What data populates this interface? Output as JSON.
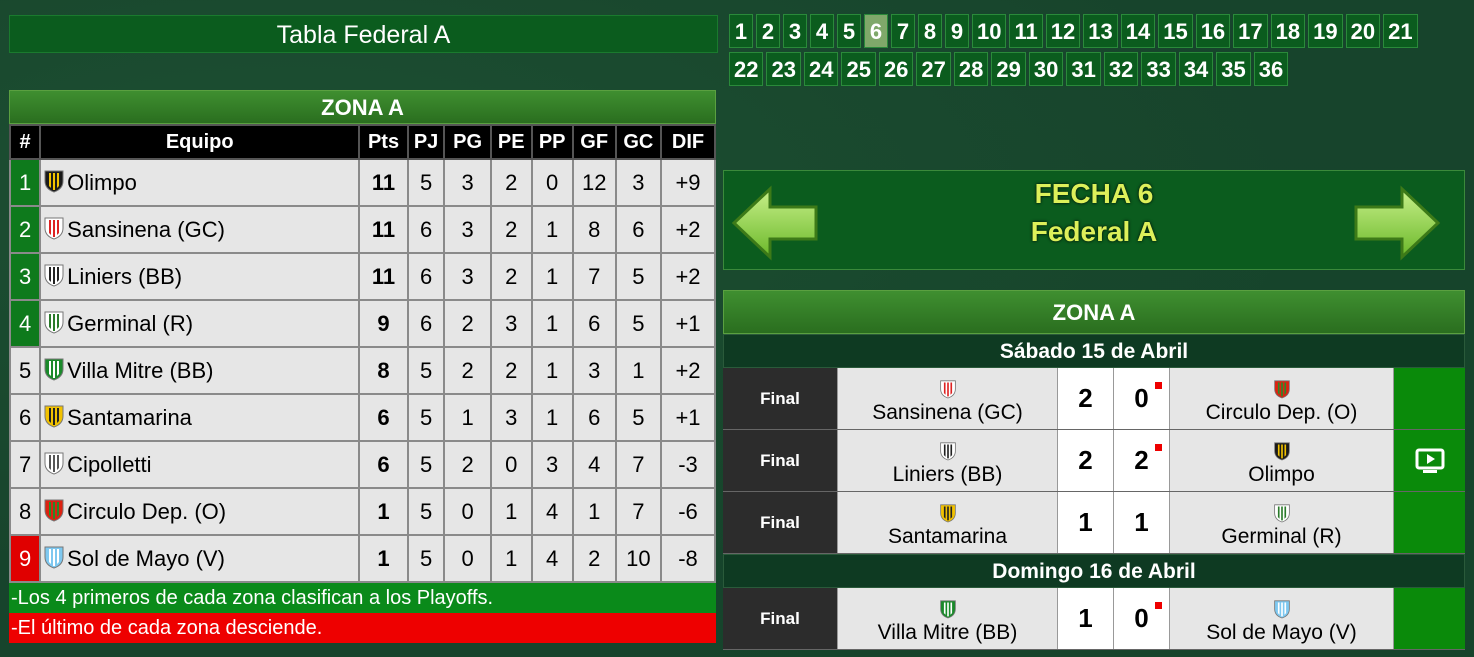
{
  "page_title": "Tabla Federal A",
  "standings": {
    "zone_title": "ZONA A",
    "columns": [
      "#",
      "Equipo",
      "Pts",
      "PJ",
      "PG",
      "PE",
      "PP",
      "GF",
      "GC",
      "DIF"
    ],
    "rows": [
      {
        "pos": "1",
        "team": "Olimpo",
        "pts": "11",
        "pj": "5",
        "pg": "3",
        "pe": "2",
        "pp": "0",
        "gf": "12",
        "gc": "3",
        "dif": "+9",
        "status": "green",
        "crest": "olimpo-crest"
      },
      {
        "pos": "2",
        "team": "Sansinena (GC)",
        "pts": "11",
        "pj": "6",
        "pg": "3",
        "pe": "2",
        "pp": "1",
        "gf": "8",
        "gc": "6",
        "dif": "+2",
        "status": "green",
        "crest": "sansinena-crest"
      },
      {
        "pos": "3",
        "team": "Liniers (BB)",
        "pts": "11",
        "pj": "6",
        "pg": "3",
        "pe": "2",
        "pp": "1",
        "gf": "7",
        "gc": "5",
        "dif": "+2",
        "status": "green",
        "crest": "liniers-crest"
      },
      {
        "pos": "4",
        "team": "Germinal (R)",
        "pts": "9",
        "pj": "6",
        "pg": "2",
        "pe": "3",
        "pp": "1",
        "gf": "6",
        "gc": "5",
        "dif": "+1",
        "status": "green",
        "crest": "germinal-crest"
      },
      {
        "pos": "5",
        "team": "Villa Mitre (BB)",
        "pts": "8",
        "pj": "5",
        "pg": "2",
        "pe": "2",
        "pp": "1",
        "gf": "3",
        "gc": "1",
        "dif": "+2",
        "status": "none",
        "crest": "villa-mitre-crest"
      },
      {
        "pos": "6",
        "team": "Santamarina",
        "pts": "6",
        "pj": "5",
        "pg": "1",
        "pe": "3",
        "pp": "1",
        "gf": "6",
        "gc": "5",
        "dif": "+1",
        "status": "none",
        "crest": "santamarina-crest"
      },
      {
        "pos": "7",
        "team": "Cipolletti",
        "pts": "6",
        "pj": "5",
        "pg": "2",
        "pe": "0",
        "pp": "3",
        "gf": "4",
        "gc": "7",
        "dif": "-3",
        "status": "none",
        "crest": "cipolletti-crest"
      },
      {
        "pos": "8",
        "team": "Circulo Dep. (O)",
        "pts": "1",
        "pj": "5",
        "pg": "0",
        "pe": "1",
        "pp": "4",
        "gf": "1",
        "gc": "7",
        "dif": "-6",
        "status": "none",
        "crest": "circulo-crest"
      },
      {
        "pos": "9",
        "team": "Sol de Mayo (V)",
        "pts": "1",
        "pj": "5",
        "pg": "0",
        "pe": "1",
        "pp": "4",
        "gf": "2",
        "gc": "10",
        "dif": "-8",
        "status": "red",
        "crest": "sol-de-mayo-crest"
      }
    ],
    "legend_playoffs": "-Los 4 primeros de cada zona clasifican a los Playoffs.",
    "legend_relegation": "-El último de cada zona desciende."
  },
  "rounds": {
    "items": [
      "1",
      "2",
      "3",
      "4",
      "5",
      "6",
      "7",
      "8",
      "9",
      "10",
      "11",
      "12",
      "13",
      "14",
      "15",
      "16",
      "17",
      "18",
      "19",
      "20",
      "21",
      "22",
      "23",
      "24",
      "25",
      "26",
      "27",
      "28",
      "29",
      "30",
      "31",
      "32",
      "33",
      "34",
      "35",
      "36"
    ],
    "active": "6"
  },
  "fecha": {
    "line1": "FECHA 6",
    "line2": "Federal A"
  },
  "results": {
    "zone_title": "ZONA A",
    "days": [
      {
        "label": "Sábado 15 de Abril",
        "matches": [
          {
            "status": "Final",
            "home": "Sansinena (GC)",
            "home_goals": "2",
            "away_goals": "0",
            "away": "Circulo Dep. (O)",
            "home_crest": "sansinena-crest",
            "away_crest": "circulo-crest",
            "video": false
          },
          {
            "status": "Final",
            "home": "Liniers (BB)",
            "home_goals": "2",
            "away_goals": "2",
            "away": "Olimpo",
            "home_crest": "liniers-crest",
            "away_crest": "olimpo-crest",
            "video": true
          },
          {
            "status": "Final",
            "home": "Santamarina",
            "home_goals": "1",
            "away_goals": "1",
            "away": "Germinal (R)",
            "home_crest": "santamarina-crest",
            "away_crest": "germinal-crest",
            "video": false
          }
        ]
      },
      {
        "label": "Domingo 16 de Abril",
        "matches": [
          {
            "status": "Final",
            "home": "Villa Mitre (BB)",
            "home_goals": "1",
            "away_goals": "0",
            "away": "Sol de Mayo (V)",
            "home_crest": "villa-mitre-crest",
            "away_crest": "sol-de-mayo-crest",
            "video": false
          }
        ]
      }
    ]
  },
  "colors": {
    "qualify": "#0e7a1c",
    "relegate": "#e00000",
    "accent_text": "#ddf05a"
  }
}
